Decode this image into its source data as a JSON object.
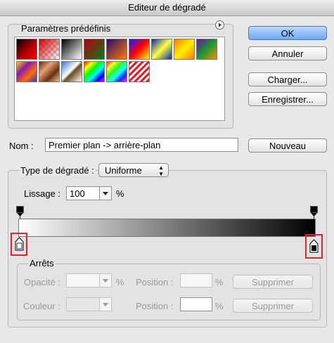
{
  "window": {
    "title": "Editeur de dégradé"
  },
  "presets": {
    "label": "Paramètres prédéfinis",
    "menu_icon": "arrow-circle-icon",
    "swatches": [
      {
        "name": "foreground-to-background"
      },
      {
        "name": "foreground-to-transparent"
      },
      {
        "name": "black-to-white"
      },
      {
        "name": "red-green"
      },
      {
        "name": "violet-orange"
      },
      {
        "name": "blue-red-yellow"
      },
      {
        "name": "blue-yellow-blue"
      },
      {
        "name": "orange-yellow-orange"
      },
      {
        "name": "violet-green-orange"
      },
      {
        "name": "yellow-violet-orange-blue"
      },
      {
        "name": "copper"
      },
      {
        "name": "chrome"
      },
      {
        "name": "spectrum"
      },
      {
        "name": "transparent-rainbow"
      },
      {
        "name": "transparent-stripes"
      }
    ]
  },
  "buttons": {
    "ok": "OK",
    "cancel": "Annuler",
    "load": "Charger...",
    "save": "Enregistrer...",
    "new": "Nouveau"
  },
  "name_field": {
    "label": "Nom :",
    "value": "Premier plan -> arrière-plan"
  },
  "gradient_type": {
    "label": "Type de dégradé :",
    "value": "Uniforme"
  },
  "smoothness": {
    "label": "Lissage :",
    "value": "100",
    "unit": "%"
  },
  "stops": {
    "label": "Arrêts",
    "opacity_label": "Opacité :",
    "opacity_unit": "%",
    "opacity_position_label": "Position :",
    "opacity_position_unit": "%",
    "delete_label": "Supprimer",
    "color_label": "Couleur :",
    "color_position_label": "Position :",
    "color_position_unit": "%",
    "delete_label_2": "Supprimer"
  },
  "colors": {
    "gradient_start": "#ffffff",
    "gradient_end": "#000000",
    "highlight": "#e8202a"
  }
}
